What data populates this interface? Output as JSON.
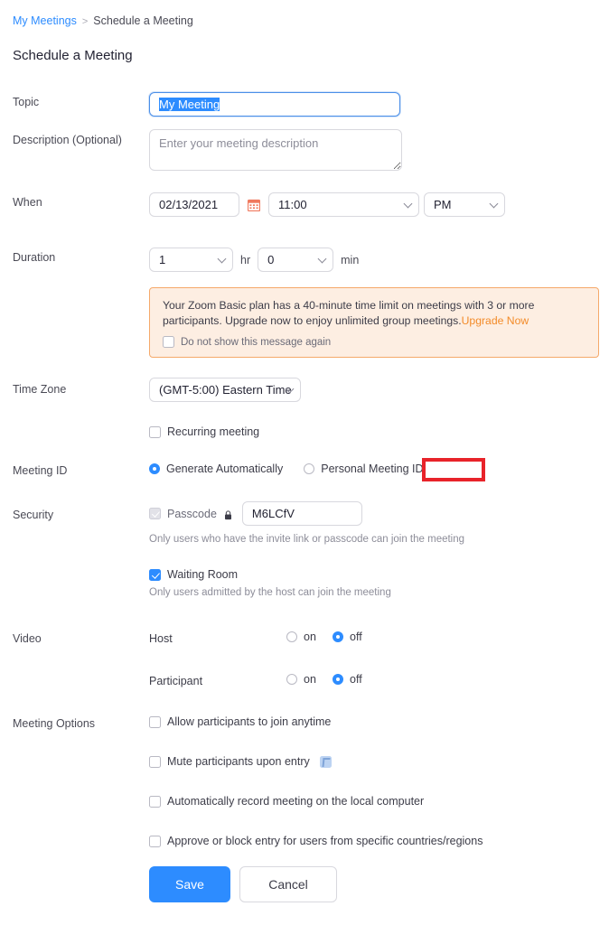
{
  "breadcrumb": {
    "parent": "My Meetings",
    "separator": ">",
    "current": "Schedule a Meeting"
  },
  "page_title": "Schedule a Meeting",
  "colors": {
    "accent_blue": "#2d8cff",
    "notice_border": "#f5a96a",
    "notice_bg": "#fdeee2",
    "notice_link": "#f38b29",
    "redaction_red": "#e8232a"
  },
  "form": {
    "topic": {
      "label": "Topic",
      "value": "My Meeting",
      "selected": true
    },
    "description": {
      "label": "Description (Optional)",
      "value": "",
      "placeholder": "Enter your meeting description"
    },
    "when": {
      "label": "When",
      "date": "02/13/2021",
      "calendar_icon": "calendar-icon",
      "time": "11:00",
      "meridiem": "PM"
    },
    "duration": {
      "label": "Duration",
      "hours": "1",
      "hours_unit": "hr",
      "minutes": "0",
      "minutes_unit": "min"
    },
    "notice": {
      "line1": "Your Zoom Basic plan has a 40-minute time limit on meetings with 3 or more participants.",
      "line2": "Upgrade now to enjoy unlimited group meetings.",
      "link": "Upgrade Now",
      "dismiss_label": "Do not show this message again",
      "dismiss_checked": false
    },
    "time_zone": {
      "label": "Time Zone",
      "value": "(GMT-5:00) Eastern Time"
    },
    "recurring": {
      "label": "Recurring meeting",
      "checked": false
    },
    "meeting_id": {
      "label": "Meeting ID",
      "option_generate": "Generate Automatically",
      "option_generate_selected": true,
      "option_personal": "Personal Meeting ID 552",
      "option_personal_selected": false,
      "redacted": true
    },
    "security": {
      "label": "Security",
      "passcode": {
        "label": "Passcode",
        "checked": true,
        "disabled": true,
        "lock_icon": "lock-icon",
        "value": "M6LCfV",
        "hint": "Only users who have the invite link or passcode can join the meeting"
      },
      "waiting_room": {
        "label": "Waiting Room",
        "checked": true,
        "hint": "Only users admitted by the host can join the meeting"
      }
    },
    "video": {
      "label": "Video",
      "rows": [
        {
          "name": "Host",
          "on_label": "on",
          "off_label": "off",
          "value": "off"
        },
        {
          "name": "Participant",
          "on_label": "on",
          "off_label": "off",
          "value": "off"
        }
      ]
    },
    "meeting_options": {
      "label": "Meeting Options",
      "items": [
        {
          "label": "Allow participants to join anytime",
          "checked": false,
          "badge": false
        },
        {
          "label": "Mute participants upon entry",
          "checked": false,
          "badge": true,
          "badge_icon": "info-badge-icon"
        },
        {
          "label": "Automatically record meeting on the local computer",
          "checked": false,
          "badge": false
        },
        {
          "label": "Approve or block entry for users from specific countries/regions",
          "checked": false,
          "badge": false
        }
      ]
    },
    "actions": {
      "save": "Save",
      "cancel": "Cancel"
    }
  }
}
